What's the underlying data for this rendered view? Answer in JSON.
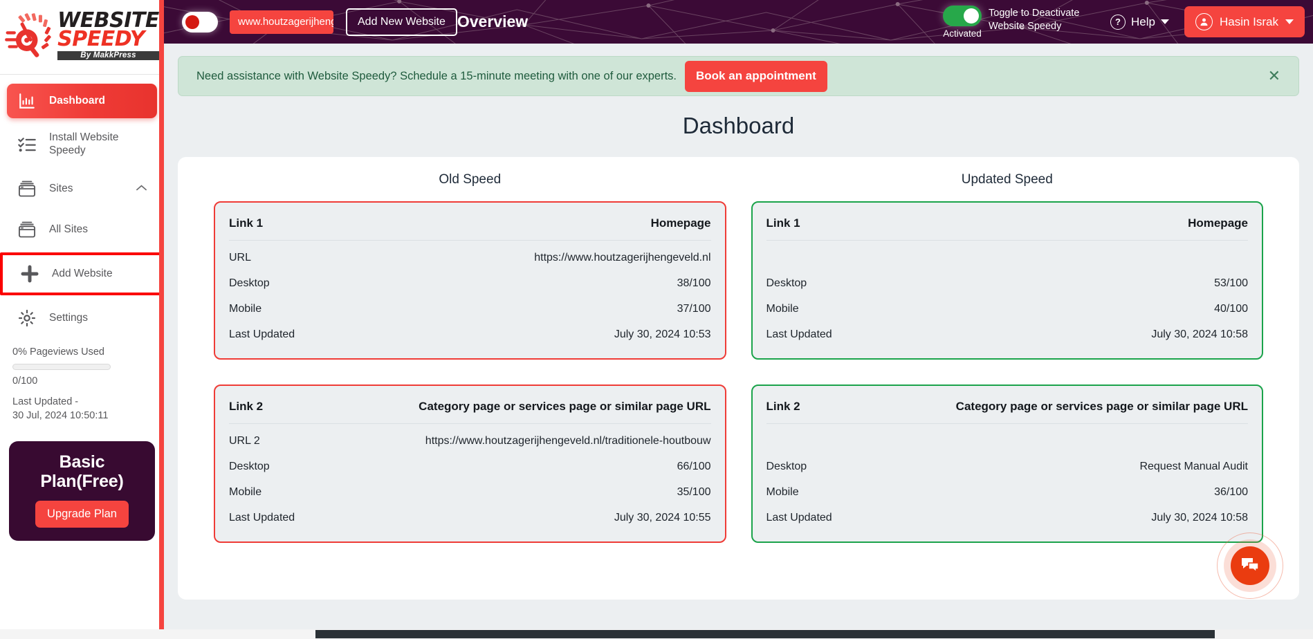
{
  "sidebar": {
    "logo": {
      "line1": "WEBSITE",
      "line2": "SPEEDY",
      "line3": "By MakkPress"
    },
    "items": [
      {
        "label": "Dashboard",
        "icon": "chart-bar-icon"
      },
      {
        "label": "Install Website Speedy",
        "icon": "checklist-icon"
      },
      {
        "label": "Sites",
        "icon": "window-stack-icon"
      },
      {
        "label": "All Sites",
        "icon": "window-stack-icon"
      },
      {
        "label": "Add Website",
        "icon": "plus-icon"
      },
      {
        "label": "Settings",
        "icon": "gear-icon"
      }
    ],
    "usage": {
      "title": "0% Pageviews Used",
      "count": "0/100",
      "progress_percent": 0,
      "last_updated": "Last Updated -\n30 Jul, 2024 10:50:11"
    },
    "plan": {
      "name": "Basic Plan(Free)",
      "upgrade_label": "Upgrade Plan"
    }
  },
  "topbar": {
    "title": "Overview",
    "site_toggle_state": "off",
    "site_pill": "www.houtzagerijhengev",
    "add_new_website": "Add New Website",
    "activation": {
      "state": "Activated",
      "description": "Toggle to Deactivate Website Speedy"
    },
    "help": "Help",
    "user": "Hasin Israk"
  },
  "banner": {
    "text": "Need assistance with Website Speedy? Schedule a 15-minute meeting with one of our experts.",
    "button": "Book an appointment",
    "close_icon": "✕"
  },
  "page": {
    "title": "Dashboard"
  },
  "columns": [
    {
      "title": "Old Speed",
      "cards": [
        {
          "head_left": "Link 1",
          "head_right": "Homepage",
          "rows": [
            {
              "key": "URL",
              "value": "https://www.houtzagerijhengeveld.nl"
            },
            {
              "key": "Desktop",
              "value": "38/100"
            },
            {
              "key": "Mobile",
              "value": "37/100"
            },
            {
              "key": "Last Updated",
              "value": "July 30, 2024 10:53"
            }
          ]
        },
        {
          "head_left": "Link 2",
          "head_right": "Category page or services page or similar page URL",
          "rows": [
            {
              "key": "URL 2",
              "value": "https://www.houtzagerijhengeveld.nl/traditionele-houtbouw"
            },
            {
              "key": "Desktop",
              "value": "66/100"
            },
            {
              "key": "Mobile",
              "value": "35/100"
            },
            {
              "key": "Last Updated",
              "value": "July 30, 2024 10:55"
            }
          ]
        }
      ]
    },
    {
      "title": "Updated Speed",
      "cards": [
        {
          "head_left": "Link 1",
          "head_right": "Homepage",
          "rows": [
            {
              "key": "",
              "value": ""
            },
            {
              "key": "Desktop",
              "value": "53/100"
            },
            {
              "key": "Mobile",
              "value": "40/100"
            },
            {
              "key": "Last Updated",
              "value": "July 30, 2024 10:58"
            }
          ]
        },
        {
          "head_left": "Link 2",
          "head_right": "Category page or services page or similar page URL",
          "rows": [
            {
              "key": "",
              "value": ""
            },
            {
              "key": "Desktop",
              "value": "Request Manual Audit"
            },
            {
              "key": "Mobile",
              "value": "36/100"
            },
            {
              "key": "Last Updated",
              "value": "July 30, 2024 10:58"
            }
          ]
        }
      ]
    }
  ],
  "chat": {
    "icon": "chat-bubbles-icon"
  },
  "colors": {
    "brand_red": "#f5443f",
    "header_purple": "#3b0a36",
    "old_border": "#ef3b36",
    "updated_border": "#1aa34a",
    "banner_green": "#cfe5d7",
    "activated_green": "#27a84a",
    "chat_orange": "#ea3c10"
  }
}
